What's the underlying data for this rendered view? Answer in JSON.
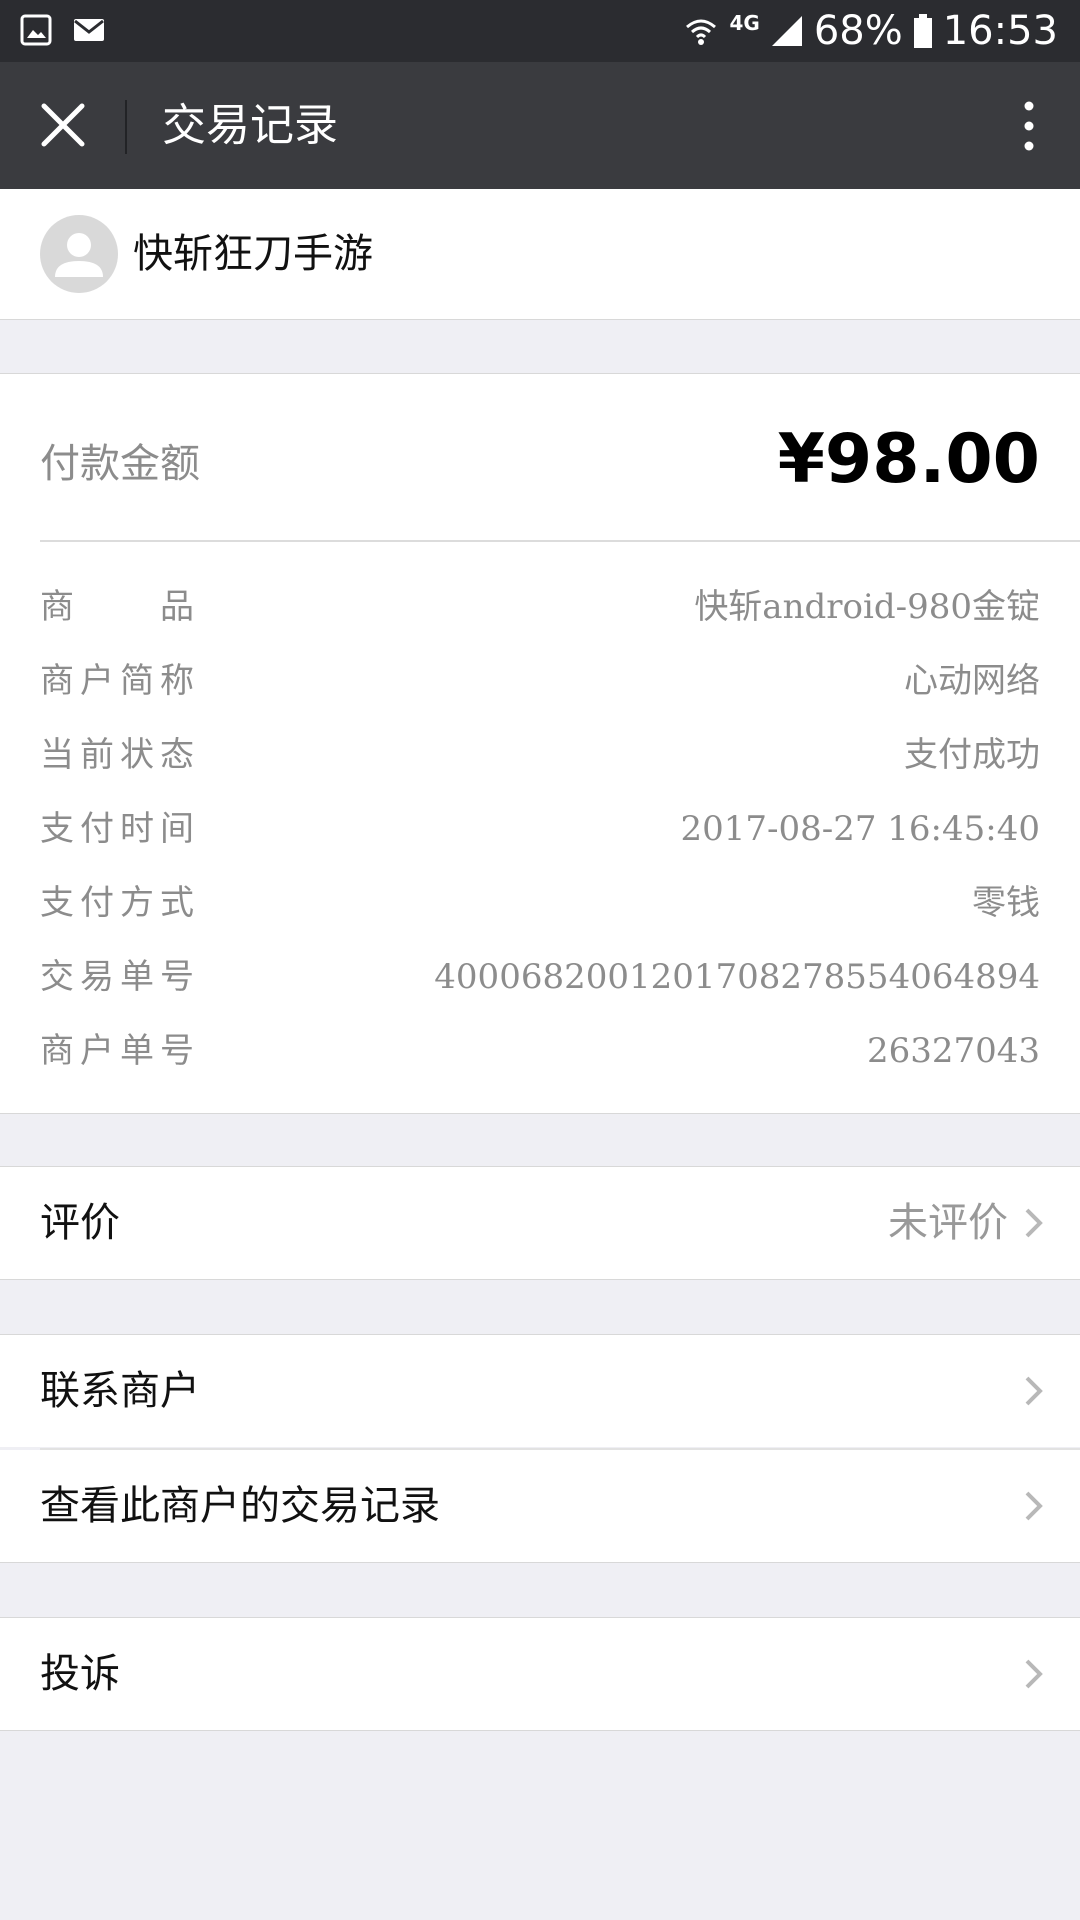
{
  "status_bar": {
    "left_icons": [
      "image-icon",
      "mail-icon"
    ],
    "network": "4G",
    "battery": "68%",
    "time": "16:53"
  },
  "nav": {
    "title": "交易记录",
    "close_icon": "close-icon",
    "more_icon": "more-vertical-icon"
  },
  "merchant": {
    "name": "快斩狂刀手游"
  },
  "payment": {
    "amount_label": "付款金额",
    "amount": "¥98.00",
    "rows": [
      {
        "label": "商　　品",
        "value": "快斩android-980金锭"
      },
      {
        "label": "商户简称",
        "value": "心动网络"
      },
      {
        "label": "当前状态",
        "value": "支付成功"
      },
      {
        "label": "支付时间",
        "value": "2017-08-27 16:45:40"
      },
      {
        "label": "支付方式",
        "value": "零钱"
      },
      {
        "label": "交易单号",
        "value": "4000682001201708278554064894"
      },
      {
        "label": "商户单号",
        "value": "26327043"
      }
    ]
  },
  "review": {
    "label": "评价",
    "value": "未评价"
  },
  "actions": {
    "contact_merchant": "联系商户",
    "view_merchant_records": "查看此商户的交易记录",
    "complain": "投诉"
  },
  "colors": {
    "status_bar": "#2b2c30",
    "nav_bar": "#3a3b3f",
    "page_background": "#efeff4"
  }
}
